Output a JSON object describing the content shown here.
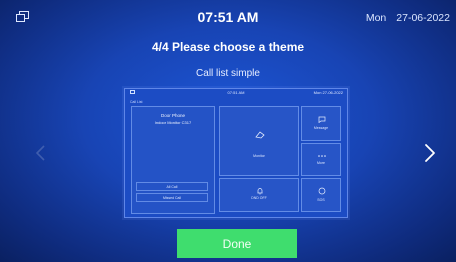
{
  "statusbar": {
    "time": "07:51 AM",
    "day": "Mon",
    "date": "27-06-2022",
    "window_icon": "window-restore-icon"
  },
  "header": {
    "title": "4/4 Please choose a theme",
    "subtitle": "Call list simple"
  },
  "preview": {
    "status_time": "07:51 AM",
    "status_date": "Mon 27-06-2022",
    "back_label": "Call List",
    "phone_title": "Door Phone",
    "device_name": "Indoor Monitor C317",
    "buttons": [
      "All Call",
      "Missed Call"
    ],
    "tiles": [
      "Monitor",
      "Message",
      "More",
      "DND OFF",
      "SOS"
    ]
  },
  "nav": {
    "next_icon": "chevron-right-icon",
    "prev_icon": "chevron-left-icon"
  },
  "footer": {
    "done_label": "Done"
  },
  "colors": {
    "background": "#1844b4",
    "done_button": "#3fdd6e"
  }
}
